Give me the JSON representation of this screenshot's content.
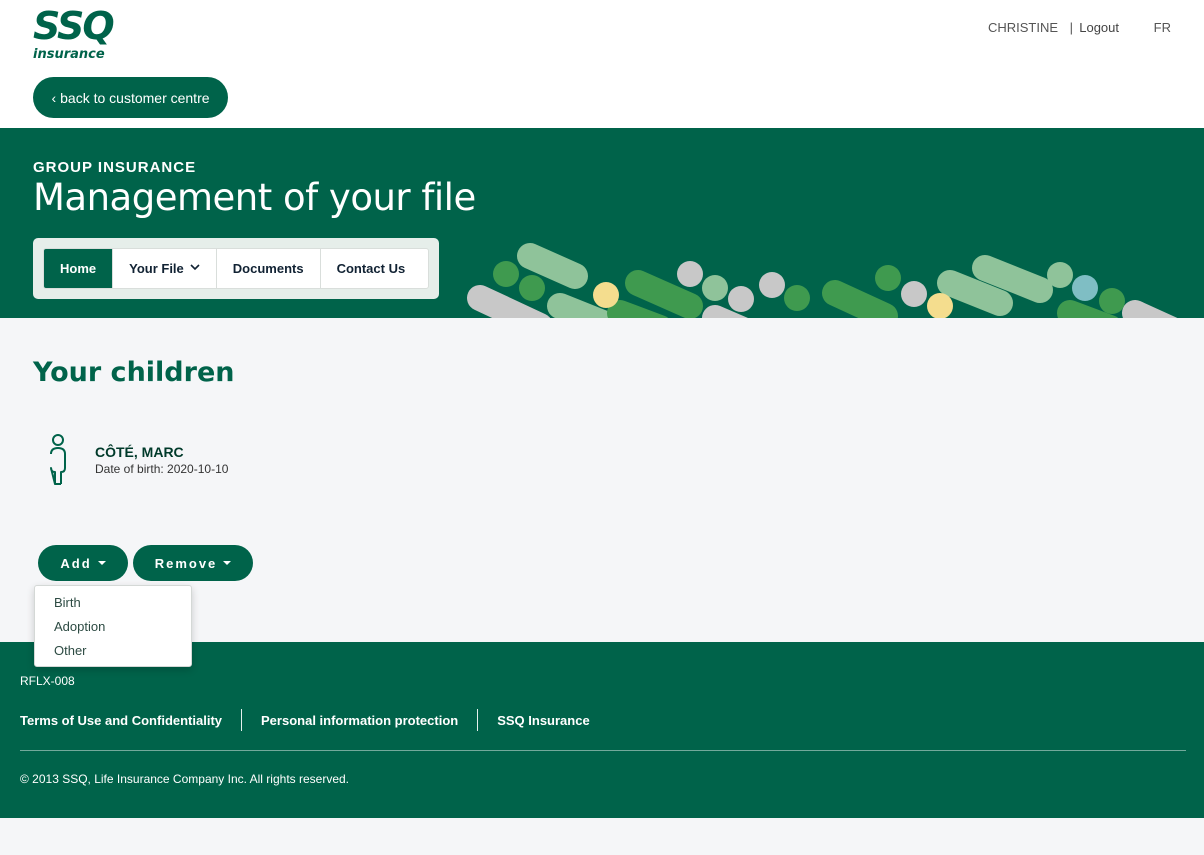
{
  "brand": {
    "logo_main": "SSQ",
    "logo_sub": "insurance"
  },
  "userbar": {
    "user": "CHRISTINE",
    "separator": "|",
    "logout": "Logout",
    "lang": "FR"
  },
  "back_button": {
    "label": "back to customer centre"
  },
  "hero": {
    "kicker": "GROUP INSURANCE",
    "title": "Management of your file"
  },
  "nav": {
    "tabs": [
      {
        "label": "Home",
        "active": true
      },
      {
        "label": "Your File",
        "has_caret": true
      },
      {
        "label": "Documents"
      },
      {
        "label": "Contact Us"
      }
    ]
  },
  "main": {
    "section_title": "Your children",
    "children": [
      {
        "name": "CÔTÉ, MARC",
        "dob": "Date of birth: 2020-10-10"
      }
    ],
    "actions": {
      "add": "Add",
      "remove": "Remove"
    },
    "add_menu": {
      "options": [
        "Birth",
        "Adoption",
        "Other"
      ]
    }
  },
  "footer": {
    "code": "RFLX-008",
    "links": [
      "Terms of Use and Confidentiality",
      "Personal information protection",
      "SSQ Insurance"
    ],
    "copyright": "© 2013 SSQ, Life Insurance Company Inc. All rights reserved."
  },
  "colors": {
    "brand_green": "#00634a",
    "background": "#f5f6f8"
  }
}
